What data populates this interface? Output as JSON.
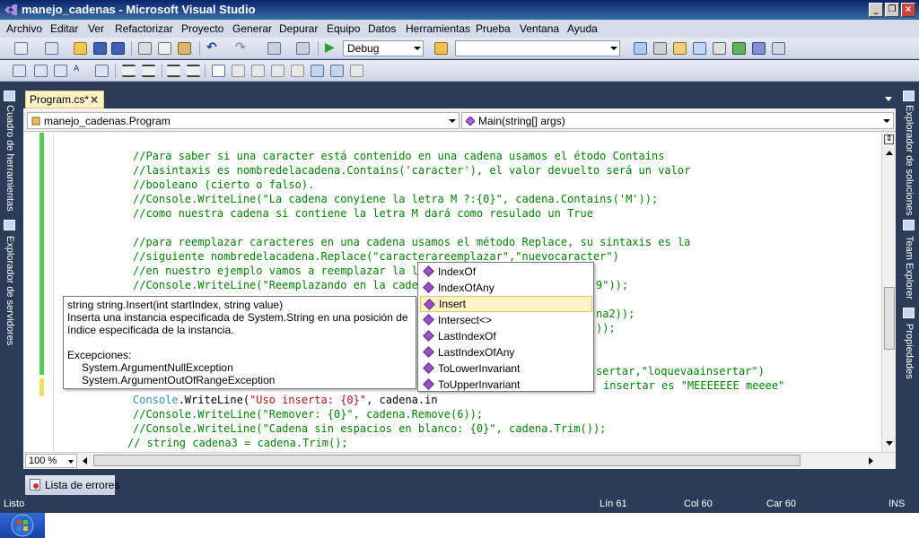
{
  "window": {
    "title": "manejo_cadenas - Microsoft Visual Studio"
  },
  "menu": [
    "Archivo",
    "Editar",
    "Ver",
    "Refactorizar",
    "Proyecto",
    "Generar",
    "Depurar",
    "Equipo",
    "Datos",
    "Herramientas",
    "Prueba",
    "Ventana",
    "Ayuda"
  ],
  "toolbar": {
    "config_value": "Debug",
    "platform_value": ""
  },
  "left_panels": [
    "Cuadro de herramientas",
    "Explorador de servidores"
  ],
  "right_panels": [
    "Explorador de soluciones",
    "Team Explorer",
    "Propiedades"
  ],
  "document": {
    "tab_label": "Program.cs*",
    "tab_close": "×",
    "nav_class": "manejo_cadenas.Program",
    "nav_member": "Main(string[] args)",
    "zoom": "100 %"
  },
  "code_lines": [
    "//Para saber si una caracter está contenido en una cadena usamos el étodo Contains",
    "//lasintaxis es nombredelacadena.Contains('caracter'), el valor devuelto será un valor",
    "//booleano (cierto o falso).",
    "//Console.WriteLine(\"La cadena conyiene la letra M ?:{0}\", cadena.Contains('M'));",
    "//como nuestra cadena si contiene la letra M dará como resulado un True",
    "",
    "//para reemplazar caracteres en una cadena usamos el método Replace, su sintaxis es la",
    "//siguiente nombredelacadena.Replace(\"caracterareemplazar\",\"nuevocaracter\")",
    "//en nuestro ejemplo vamos a reemplazar la le",
    "//Console.WriteLine(\"Reemplazando en la caden",
    "",
    "",
    "",
    "",
    "",
    "",
    "",
    "//Console.WriteLine(\"Remover: {0}\", cadena.Remove(6));",
    "//Console.WriteLine(\"Cadena sin espacios en blanco: {0}\", cadena.Trim());"
  ],
  "code_fragments": {
    "line9_tail": "9\"));",
    "line11_tail": "na2));",
    "line12_tail": "));",
    "line15_tail": "sertar,\"loquevaainsertar\")",
    "line16_tail": "insertar es \"MEEEEEEE meeee\"",
    "active_line_type": "Console",
    "active_line_rest": ".WriteLine(",
    "active_line_str": "\"Uso inserta: {0}\"",
    "active_line_end": ", cadena.in",
    "last_line": "// string cadena3 = cadena.Trim();"
  },
  "tooltip": {
    "signature": "string string.Insert(int startIndex, string value)",
    "desc1": "Inserta una instancia especificada de System.String en una posición de",
    "desc2": "índice especificada de la instancia.",
    "exceptions_label": "Excepciones:",
    "exc1": "System.ArgumentNullException",
    "exc2": "System.ArgumentOutOfRangeException"
  },
  "completion": [
    "IndexOf",
    "IndexOfAny",
    "Insert",
    "Intersect<>",
    "LastIndexOf",
    "LastIndexOfAny",
    "ToLowerInvariant",
    "ToUpperInvariant"
  ],
  "completion_selected": "Insert",
  "bottom": {
    "error_tab": "Lista de errores"
  },
  "status": {
    "ready": "Listo",
    "line": "Lín 61",
    "col": "Col 60",
    "car": "Car 60",
    "mode": "INS"
  }
}
